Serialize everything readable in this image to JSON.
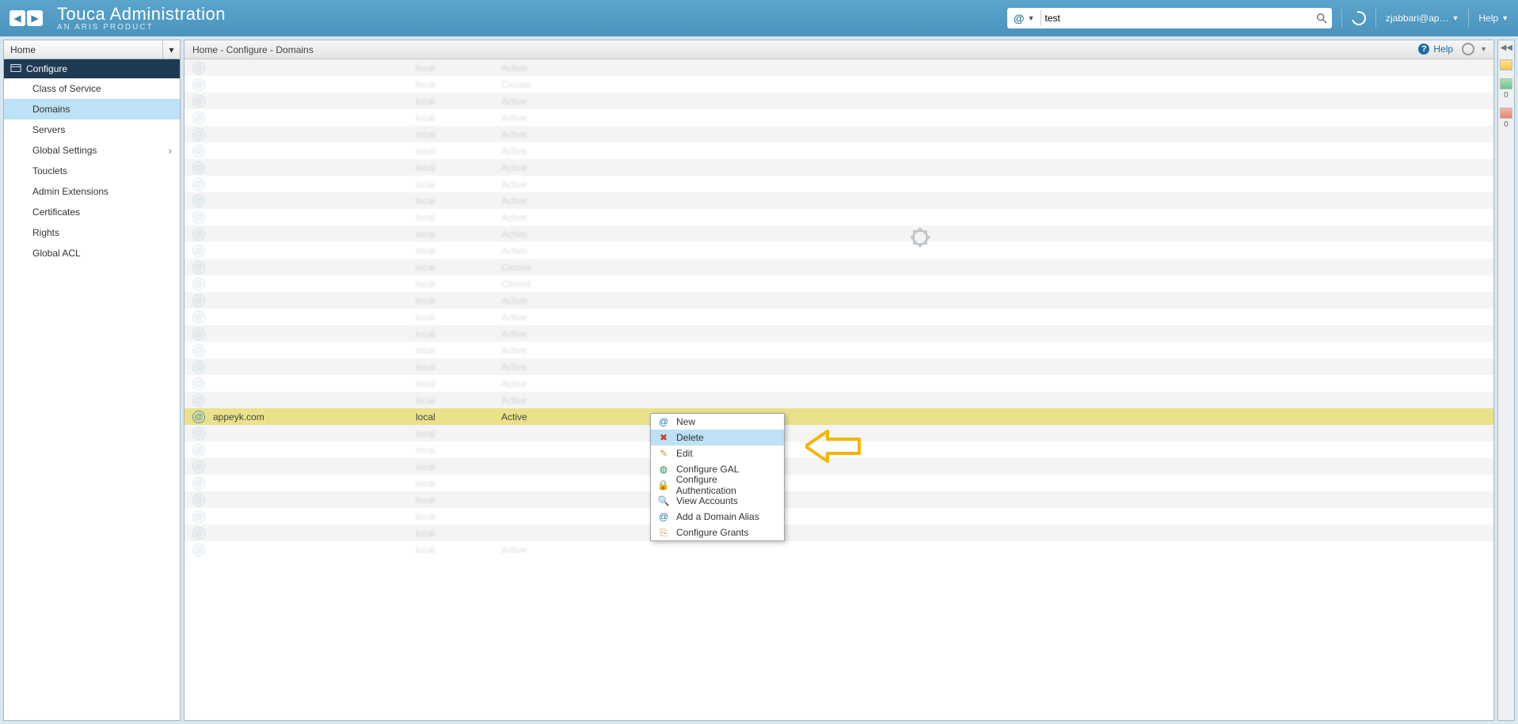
{
  "brand": {
    "title": "Touca Administration",
    "subtitle": "AN ARIS PRODUCT"
  },
  "header": {
    "search_type_icon": "@",
    "search_value": "test",
    "refresh_title": "Refresh",
    "user_label": "zjabbari@ap…",
    "help_label": "Help"
  },
  "sidebar": {
    "dropdown_label": "Home",
    "section_label": "Configure",
    "items": [
      {
        "label": "Class of Service",
        "active": false,
        "hasSub": false
      },
      {
        "label": "Domains",
        "active": true,
        "hasSub": false
      },
      {
        "label": "Servers",
        "active": false,
        "hasSub": false
      },
      {
        "label": "Global Settings",
        "active": false,
        "hasSub": true
      },
      {
        "label": "Touclets",
        "active": false,
        "hasSub": false
      },
      {
        "label": "Admin Extensions",
        "active": false,
        "hasSub": false
      },
      {
        "label": "Certificates",
        "active": false,
        "hasSub": false
      },
      {
        "label": "Rights",
        "active": false,
        "hasSub": false
      },
      {
        "label": "Global ACL",
        "active": false,
        "hasSub": false
      }
    ]
  },
  "breadcrumb": {
    "path": "Home - Configure - Domains",
    "help_label": "Help"
  },
  "rows": [
    {
      "name": "",
      "type": "local",
      "status": "Active",
      "faded": true
    },
    {
      "name": "",
      "type": "local",
      "status": "Closed",
      "faded": true
    },
    {
      "name": "",
      "type": "local",
      "status": "Active",
      "faded": true
    },
    {
      "name": "",
      "type": "local",
      "status": "Active",
      "faded": true
    },
    {
      "name": "",
      "type": "local",
      "status": "Active",
      "faded": true
    },
    {
      "name": "",
      "type": "local",
      "status": "Active",
      "faded": true
    },
    {
      "name": "",
      "type": "local",
      "status": "Active",
      "faded": true
    },
    {
      "name": "",
      "type": "local",
      "status": "Active",
      "faded": true
    },
    {
      "name": "",
      "type": "local",
      "status": "Active",
      "faded": true
    },
    {
      "name": "",
      "type": "local",
      "status": "Active",
      "faded": true
    },
    {
      "name": "",
      "type": "local",
      "status": "Active",
      "faded": true
    },
    {
      "name": "",
      "type": "local",
      "status": "Active",
      "faded": true
    },
    {
      "name": "",
      "type": "local",
      "status": "Closed",
      "faded": true
    },
    {
      "name": "",
      "type": "local",
      "status": "Closed",
      "faded": true
    },
    {
      "name": "",
      "type": "local",
      "status": "Active",
      "faded": true
    },
    {
      "name": "",
      "type": "local",
      "status": "Active",
      "faded": true
    },
    {
      "name": "",
      "type": "local",
      "status": "Active",
      "faded": true
    },
    {
      "name": "",
      "type": "local",
      "status": "Active",
      "faded": true
    },
    {
      "name": "",
      "type": "local",
      "status": "Active",
      "faded": true
    },
    {
      "name": "",
      "type": "local",
      "status": "Active",
      "faded": true
    },
    {
      "name": "",
      "type": "local",
      "status": "Active",
      "faded": true
    },
    {
      "name": "appeyk.com",
      "type": "local",
      "status": "Active",
      "faded": false,
      "selected": true
    },
    {
      "name": "",
      "type": "local",
      "status": "",
      "faded": true
    },
    {
      "name": "",
      "type": "local",
      "status": "",
      "faded": true
    },
    {
      "name": "",
      "type": "local",
      "status": "",
      "faded": true
    },
    {
      "name": "",
      "type": "local",
      "status": "",
      "faded": true
    },
    {
      "name": "",
      "type": "local",
      "status": "",
      "faded": true
    },
    {
      "name": "",
      "type": "local",
      "status": "",
      "faded": true
    },
    {
      "name": "",
      "type": "local",
      "status": "",
      "faded": true
    },
    {
      "name": "",
      "type": "local",
      "status": "Active",
      "faded": true
    }
  ],
  "context_menu": {
    "items": [
      {
        "icon": "@",
        "label": "New",
        "hot": false,
        "color": "#2a74a4"
      },
      {
        "icon": "✖",
        "label": "Delete",
        "hot": true,
        "color": "#d03b2e"
      },
      {
        "icon": "✎",
        "label": "Edit",
        "hot": false,
        "color": "#c79a35"
      },
      {
        "icon": "◍",
        "label": "Configure GAL",
        "hot": false,
        "color": "#2e8b57"
      },
      {
        "icon": "🔒",
        "label": "Configure Authentication",
        "hot": false,
        "color": "#c79a35"
      },
      {
        "icon": "🔍",
        "label": "View Accounts",
        "hot": false,
        "color": "#666666"
      },
      {
        "icon": "@",
        "label": "Add a Domain Alias",
        "hot": false,
        "color": "#2a74a4"
      },
      {
        "icon": "⎘",
        "label": "Configure Grants",
        "hot": false,
        "color": "#c79a35"
      }
    ]
  },
  "right_rail": {
    "count1": "0",
    "count2": "0"
  }
}
